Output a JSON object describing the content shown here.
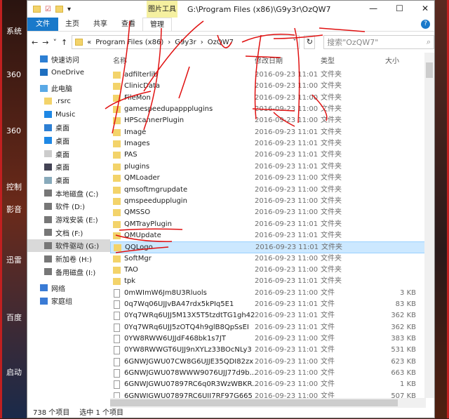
{
  "desktop": {
    "labels": [
      "系统",
      "360",
      "360",
      "控制",
      "影音",
      "迅雷",
      "百度",
      "启动"
    ]
  },
  "window": {
    "title": "G:\\Program Files (x86)\\G9y3r\\OzQW7",
    "context_tab": "图片工具",
    "minimize": "—",
    "maximize": "☐",
    "close": "✕"
  },
  "ribbon": {
    "tabs": [
      "文件",
      "主页",
      "共享",
      "查看",
      "管理"
    ],
    "help": "?"
  },
  "nav": {
    "back": "←",
    "forward": "→",
    "recent": "˅",
    "up": "↑",
    "breadcrumb": [
      "«",
      "Program Files (x86)",
      "›",
      "G9y3r",
      "›",
      "OzQW7"
    ],
    "dropdown": "˅",
    "refresh": "↻",
    "search_placeholder": "搜索\"OzQW7\"",
    "search_icon": "⌕"
  },
  "sidebar": [
    {
      "label": "快速访问",
      "icon": "star-icon"
    },
    {
      "label": "OneDrive",
      "icon": "cloud-icon"
    },
    {
      "label": "此电脑",
      "icon": "computer-icon"
    },
    {
      "label": ".rsrc",
      "icon": "folder-icon",
      "sub": true
    },
    {
      "label": "Music",
      "icon": "music-icon",
      "sub": true
    },
    {
      "label": "桌面",
      "icon": "download-icon",
      "sub": true
    },
    {
      "label": "桌面",
      "icon": "desktop-icon",
      "sub": true
    },
    {
      "label": "桌面",
      "icon": "document-icon",
      "sub": true
    },
    {
      "label": "桌面",
      "icon": "video-icon",
      "sub": true
    },
    {
      "label": "桌面",
      "icon": "picture-icon",
      "sub": true
    },
    {
      "label": "本地磁盘 (C:)",
      "icon": "drive-icon",
      "sub": true
    },
    {
      "label": "软件 (D:)",
      "icon": "drive-icon",
      "sub": true
    },
    {
      "label": "游戏安装 (E:)",
      "icon": "drive-icon",
      "sub": true
    },
    {
      "label": "文档 (F:)",
      "icon": "drive-icon",
      "sub": true
    },
    {
      "label": "软件驱动 (G:)",
      "icon": "drive-icon",
      "sub": true,
      "selected": true
    },
    {
      "label": "新加卷 (H:)",
      "icon": "drive-icon",
      "sub": true
    },
    {
      "label": "备用磁盘 (I:)",
      "icon": "drive-icon",
      "sub": true
    },
    {
      "label": "网络",
      "icon": "network-icon"
    },
    {
      "label": "家庭组",
      "icon": "homegroup-icon"
    }
  ],
  "columns": {
    "name": "名称",
    "date": "修改日期",
    "type": "类型",
    "size": "大小"
  },
  "files": [
    {
      "name": "adfilterlib",
      "date": "2016-09-23 11:01",
      "type": "文件夹",
      "size": "",
      "folder": true
    },
    {
      "name": "ClinicData",
      "date": "2016-09-23 11:00",
      "type": "文件夹",
      "size": "",
      "folder": true
    },
    {
      "name": "FileMon",
      "date": "2016-09-23 11:00",
      "type": "文件夹",
      "size": "",
      "folder": true
    },
    {
      "name": "gamespeedupappplugins",
      "date": "2016-09-23 11:00",
      "type": "文件夹",
      "size": "",
      "folder": true
    },
    {
      "name": "HPScannerPlugin",
      "date": "2016-09-23 11:00",
      "type": "文件夹",
      "size": "",
      "folder": true
    },
    {
      "name": "Image",
      "date": "2016-09-23 11:01",
      "type": "文件夹",
      "size": "",
      "folder": true
    },
    {
      "name": "Images",
      "date": "2016-09-23 11:01",
      "type": "文件夹",
      "size": "",
      "folder": true
    },
    {
      "name": "PAS",
      "date": "2016-09-23 11:01",
      "type": "文件夹",
      "size": "",
      "folder": true
    },
    {
      "name": "plugins",
      "date": "2016-09-23 11:01",
      "type": "文件夹",
      "size": "",
      "folder": true
    },
    {
      "name": "QMLoader",
      "date": "2016-09-23 11:00",
      "type": "文件夹",
      "size": "",
      "folder": true
    },
    {
      "name": "qmsoftmgrupdate",
      "date": "2016-09-23 11:00",
      "type": "文件夹",
      "size": "",
      "folder": true
    },
    {
      "name": "qmspeedupplugin",
      "date": "2016-09-23 11:00",
      "type": "文件夹",
      "size": "",
      "folder": true
    },
    {
      "name": "QMSSO",
      "date": "2016-09-23 11:00",
      "type": "文件夹",
      "size": "",
      "folder": true
    },
    {
      "name": "QMTrayPlugin",
      "date": "2016-09-23 11:01",
      "type": "文件夹",
      "size": "",
      "folder": true
    },
    {
      "name": "QMUpdate",
      "date": "2016-09-23 11:01",
      "type": "文件夹",
      "size": "",
      "folder": true
    },
    {
      "name": "QQLogo",
      "date": "2016-09-23 11:01",
      "type": "文件夹",
      "size": "",
      "folder": true,
      "selected": true
    },
    {
      "name": "SoftMgr",
      "date": "2016-09-23 11:00",
      "type": "文件夹",
      "size": "",
      "folder": true
    },
    {
      "name": "TAO",
      "date": "2016-09-23 11:00",
      "type": "文件夹",
      "size": "",
      "folder": true
    },
    {
      "name": "tpk",
      "date": "2016-09-23 11:01",
      "type": "文件夹",
      "size": "",
      "folder": true
    },
    {
      "name": "0mWImW6Jm8U3Rluols",
      "date": "2016-09-23 11:00",
      "type": "文件",
      "size": "3 KB"
    },
    {
      "name": "0q7Wq06UJJvBA47rdx5kPIq5E1",
      "date": "2016-09-23 11:01",
      "type": "文件",
      "size": "83 KB"
    },
    {
      "name": "0Yq7WRq6UJJ5M13X5T5tzdtTG1gh42",
      "date": "2016-09-23 11:01",
      "type": "文件",
      "size": "362 KB"
    },
    {
      "name": "0Yq7WRq6UJJ5zOTQ4h9glB8QpSsEI",
      "date": "2016-09-23 11:01",
      "type": "文件",
      "size": "362 KB"
    },
    {
      "name": "0YW8RWW6UJJdF468bk1s7JT",
      "date": "2016-09-23 11:00",
      "type": "文件",
      "size": "383 KB"
    },
    {
      "name": "0YW8RWWGT6UJJ9nXYLz33BOcNLy3",
      "date": "2016-09-23 11:01",
      "type": "文件",
      "size": "531 KB"
    },
    {
      "name": "6GNWJGWU07CW8G6UJJE35QDI82zx",
      "date": "2016-09-23 11:00",
      "type": "文件",
      "size": "623 KB"
    },
    {
      "name": "6GNWJGWU078WWW9076UJJ77d9b...",
      "date": "2016-09-23 11:00",
      "type": "文件",
      "size": "663 KB"
    },
    {
      "name": "6GNWJGWU07897RC6q0R3WzWBKR...",
      "date": "2016-09-23 11:00",
      "type": "文件",
      "size": "1 KB"
    },
    {
      "name": "6GNWJGWU07897RC6UJJ7RF97G665",
      "date": "2016-09-23 11:00",
      "type": "文件",
      "size": "507 KB"
    }
  ],
  "status": {
    "count": "738 个项目",
    "selected": "选中 1 个项目"
  },
  "colors": {
    "accent": "#1979ca",
    "selection": "#cce8ff",
    "context_tab": "#f5f0a0",
    "ink": "#e01010"
  }
}
